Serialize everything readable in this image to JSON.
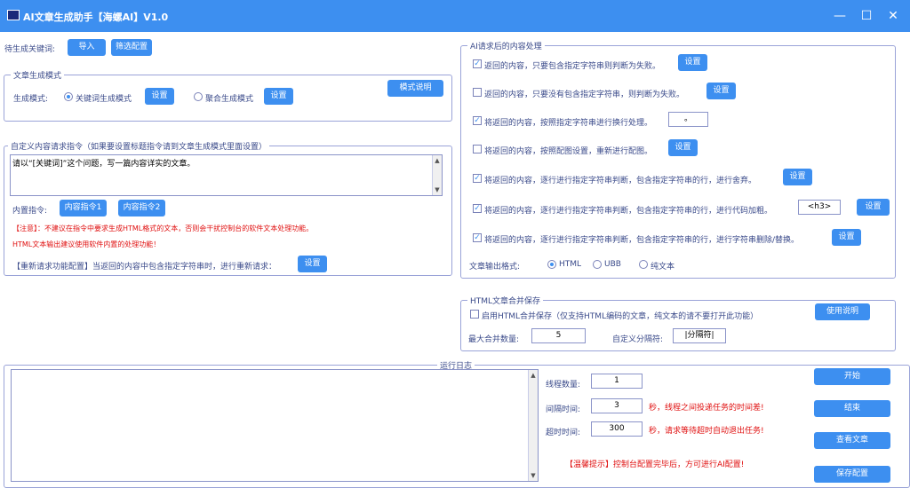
{
  "titlebar": {
    "title": "AI文章生成助手【海螺AI】V1.0"
  },
  "keywords": {
    "label": "待生成关键词:",
    "import_btn": "导入",
    "filter_btn": "筛选配置"
  },
  "mode": {
    "group_title": "文章生成模式",
    "label": "生成模式:",
    "opt1": "关键词生成模式",
    "opt2": "聚合生成模式",
    "set": "设置",
    "help_btn": "模式说明"
  },
  "prompt": {
    "group_title": "自定义内容请求指令（如果要设置标题指令请到文章生成模式里面设置）",
    "text": "请以“[关键词]”这个问题，写一篇内容详实的文章。",
    "builtin_label": "内置指令:",
    "cmd1": "内容指令1",
    "cmd2": "内容指令2",
    "note1": "【注意】：不建议在指令中要求生成HTML格式的文本，否则会干扰控制台的软件文本处理功能。",
    "note2": "HTML文本输出建议使用软件内置的处理功能！",
    "retry": "【重新请求功能配置】当返回的内容中包含指定字符串时，进行重新请求：",
    "set": "设置"
  },
  "post": {
    "group_title": "AI请求后的内容处理",
    "set": "设置",
    "rows": [
      {
        "checked": true,
        "text": "返回的内容，只要包含指定字符串则判断为失败。"
      },
      {
        "checked": false,
        "text": "返回的内容，只要没有包含指定字符串，则判断为失败。"
      },
      {
        "checked": true,
        "text": "将返回的内容，按照指定字符串进行换行处理。",
        "value": "。"
      },
      {
        "checked": false,
        "text": "将返回的内容，按照配图设置，重新进行配图。"
      },
      {
        "checked": true,
        "text": "将返回的内容，逐行进行指定字符串判断，包含指定字符串的行，进行舍弃。"
      },
      {
        "checked": true,
        "text": "将返回的内容，逐行进行指定字符串判断，包含指定字符串的行，进行代码加粗。",
        "value": "<h3>"
      },
      {
        "checked": true,
        "text": "将返回的内容，逐行进行指定字符串判断，包含指定字符串的行，进行字符串删除/替换。"
      }
    ],
    "format_label": "文章输出格式:",
    "fmt1": "HTML",
    "fmt2": "UBB",
    "fmt3": "纯文本"
  },
  "merge": {
    "group_title": "HTML文章合并保存",
    "enable": "启用HTML合并保存（仅支持HTML编码的文章，纯文本的请不要打开此功能）",
    "help_btn": "使用说明",
    "max_label": "最大合并数量:",
    "max_value": "5",
    "sep_label": "自定义分隔符:",
    "sep_value": "|分隔符|"
  },
  "log": {
    "group_title": "运行日志"
  },
  "run": {
    "threads_label": "线程数量:",
    "threads": "1",
    "interval_label": "间隔时间:",
    "interval": "3",
    "interval_desc": "秒，线程之间投递任务的时间差!",
    "timeout_label": "超时时间:",
    "timeout": "300",
    "timeout_desc": "秒，请求等待超时自动退出任务!",
    "tip": "【温馨提示】控制台配置完毕后，方可进行AI配置!",
    "start": "开始",
    "stop": "结束",
    "view": "查看文章",
    "save": "保存配置"
  }
}
